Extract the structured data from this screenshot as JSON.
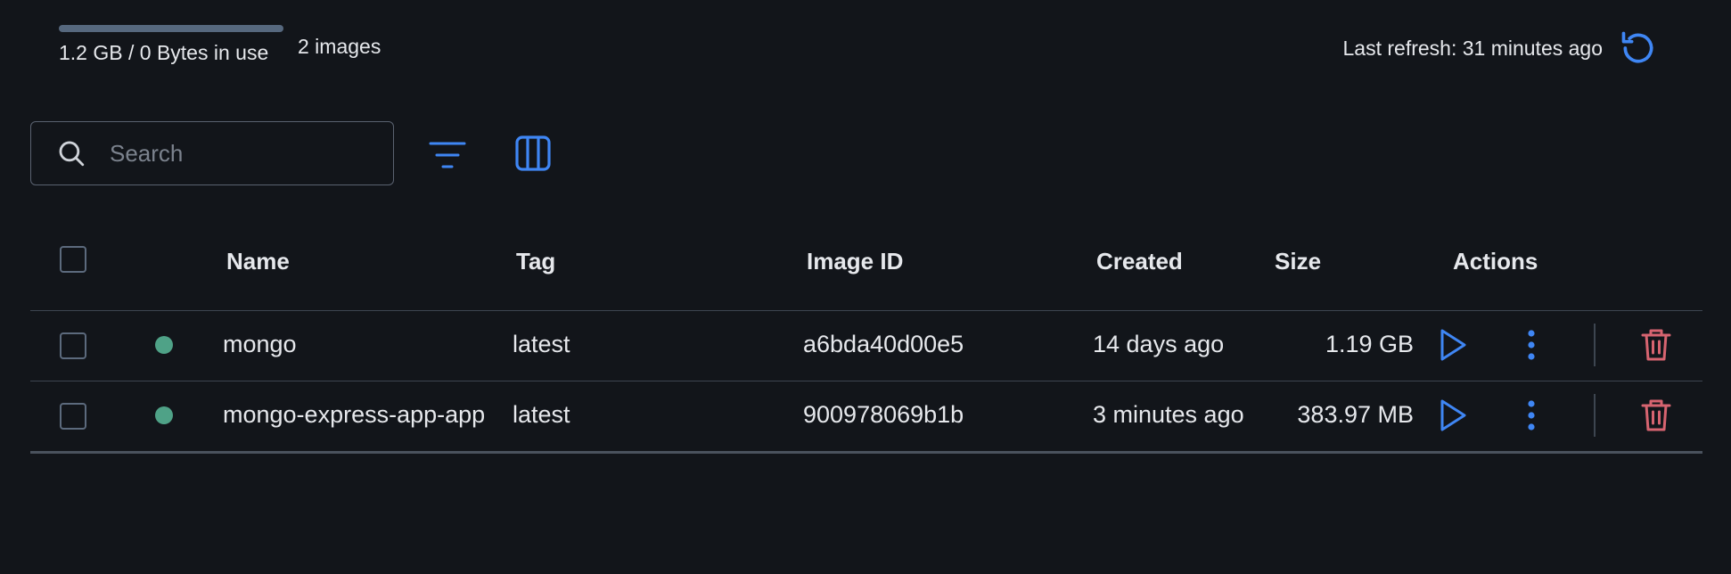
{
  "usage": {
    "text": "1.2 GB / 0 Bytes in use",
    "images_count": "2 images",
    "bar_fill_fraction": 1.0
  },
  "refresh": {
    "text": "Last refresh: 31 minutes ago",
    "icon": "refresh-icon"
  },
  "toolbar": {
    "search_placeholder": "Search",
    "search_value": "",
    "filter_icon": "filter-icon",
    "columns_icon": "columns-icon"
  },
  "table": {
    "headers": {
      "name": "Name",
      "tag": "Tag",
      "image_id": "Image ID",
      "created": "Created",
      "size": "Size",
      "actions": "Actions"
    },
    "rows": [
      {
        "status": "running",
        "name": "mongo",
        "tag": "latest",
        "image_id": "a6bda40d00e5",
        "created": "14 days ago",
        "size": "1.19 GB"
      },
      {
        "status": "running",
        "name": "mongo-express-app-app",
        "tag": "latest",
        "image_id": "900978069b1b",
        "created": "3 minutes ago",
        "size": "383.97 MB"
      }
    ]
  },
  "colors": {
    "background": "#12151a",
    "accent": "#3f86f4",
    "status_green": "#4fa287",
    "danger": "#d76470",
    "usage_bar": "#56687e"
  }
}
